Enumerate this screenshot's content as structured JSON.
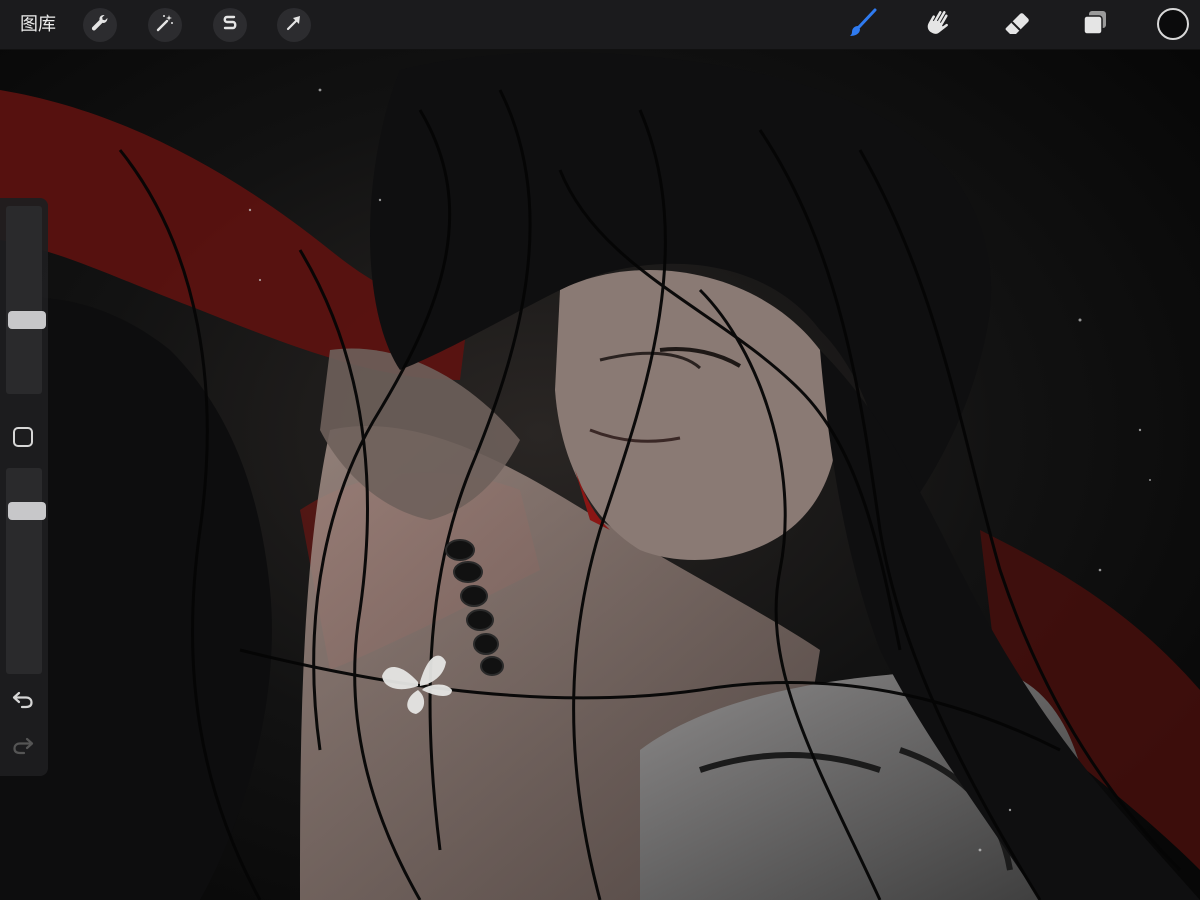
{
  "topbar": {
    "gallery_label": "图库",
    "left_tools": [
      {
        "icon": "wrench-icon"
      },
      {
        "icon": "magic-wand-icon"
      },
      {
        "icon": "selection-s-icon"
      },
      {
        "icon": "transform-arrow-icon"
      }
    ],
    "right_tools": [
      {
        "icon": "brush-icon",
        "active": true
      },
      {
        "icon": "smudge-icon"
      },
      {
        "icon": "eraser-icon"
      },
      {
        "icon": "layers-icon"
      }
    ],
    "current_color": "#0b0b0c"
  },
  "sidebar": {
    "brush_size_level": 0.38,
    "opacity_level": 0.82,
    "icons": [
      "modify-square-icon",
      "undo-icon",
      "redo-icon"
    ]
  },
  "colors": {
    "accent": "#2f7bf0",
    "toolbar_bg": "#1b1b1d",
    "canvas_bg": "#090909",
    "art_red": "#6e1512",
    "art_skin": "#8c7b74"
  }
}
